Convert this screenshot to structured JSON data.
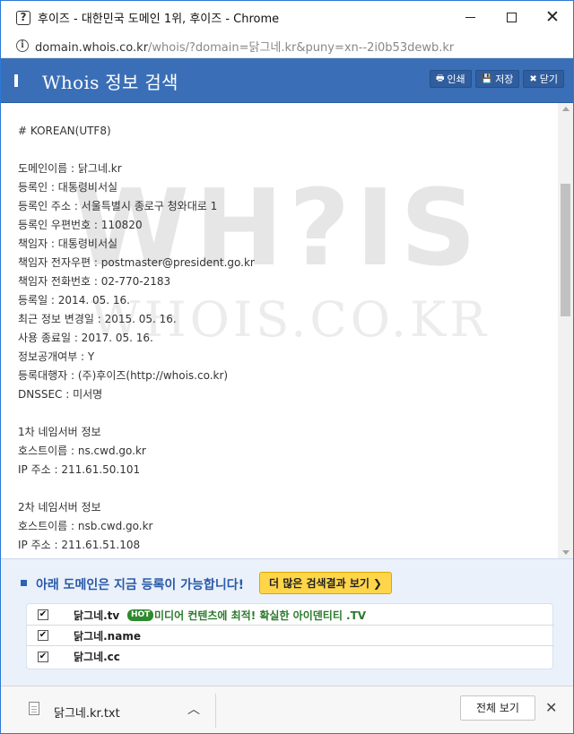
{
  "window": {
    "title": "후이즈 - 대한민국 도메인 1위, 후이즈 - Chrome",
    "favicon_glyph": "?"
  },
  "address": {
    "host": "domain.whois.co.kr",
    "path": "/whois/?domain=닭그네.kr&puny=xn--2i0b53dewb.kr"
  },
  "header": {
    "title": "Whois 정보 검색",
    "buttons": {
      "print": "인쇄",
      "save": "저장",
      "close": "닫기"
    }
  },
  "watermark": {
    "big": "WH?IS",
    "small": "WHOIS.CO.KR"
  },
  "whois_lines": [
    "# KOREAN(UTF8)",
    "",
    "도메인이름 : 닭그네.kr",
    "등록인 : 대통령비서실",
    "등록인 주소 : 서울특별시 종로구 청와대로 1",
    "등록인 우편번호 : 110820",
    "책임자 : 대통령비서실",
    "책임자 전자우편 : postmaster@president.go.kr",
    "책임자 전화번호 : 02-770-2183",
    "등록일 : 2014. 05. 16.",
    "최근 정보 변경일 : 2015. 05. 16.",
    "사용 종료일 : 2017. 05. 16.",
    "정보공개여부 : Y",
    "등록대행자 : (주)후이즈(http://whois.co.kr)",
    "DNSSEC : 미서명",
    "",
    "1차 네임서버 정보",
    "호스트이름 : ns.cwd.go.kr",
    "IP 주소 : 211.61.50.101",
    "",
    "2차 네임서버 정보",
    "호스트이름 : nsb.cwd.go.kr",
    "IP 주소 : 211.61.51.108"
  ],
  "available": {
    "title": "아래 도메인은 지금 등록이 가능합니다!",
    "more_button": "더 많은 검색결과 보기",
    "domains": [
      {
        "name": "닭그네.tv",
        "checked": true,
        "hot": "HOT",
        "promo": "미디어 컨텐츠에 최적! 확실한 아이덴티티 .TV"
      },
      {
        "name": "닭그네.name",
        "checked": true
      },
      {
        "name": "닭그네.cc",
        "checked": true
      }
    ]
  },
  "download": {
    "file_name": "닭그네.kr.txt",
    "show_all": "전체 보기"
  },
  "colors": {
    "header_blue": "#3a6fb7",
    "available_title": "#2a5aa8",
    "more_button_yellow": "#ffd54a",
    "hot_green": "#2d8a2d"
  }
}
